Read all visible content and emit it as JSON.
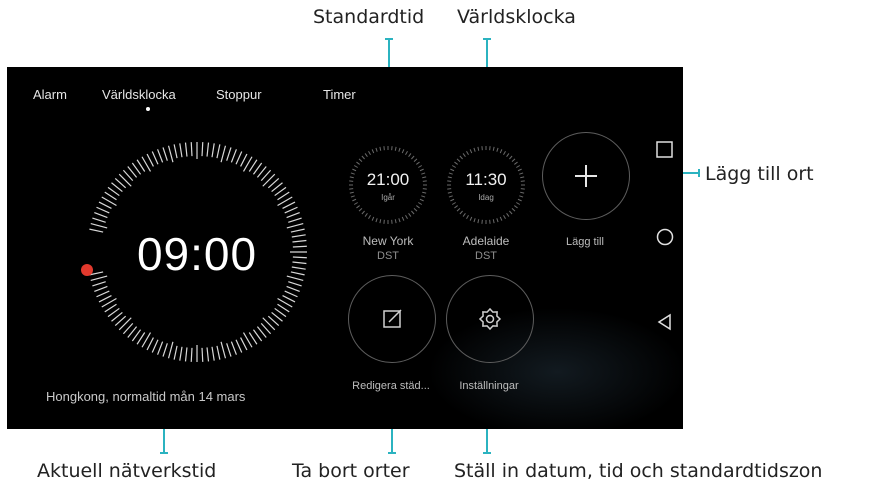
{
  "callouts": {
    "standardtid": "Standardtid",
    "varldsklocka": "Världsklocka",
    "lagg_till_ort": "Lägg till ort",
    "aktuell": "Aktuell nätverkstid",
    "ta_bort": "Ta bort orter",
    "stall_in": "Ställ in datum, tid och standardtidszon"
  },
  "tabs": [
    {
      "label": "Alarm"
    },
    {
      "label": "Världsklocka"
    },
    {
      "label": "Stoppur"
    },
    {
      "label": "Timer"
    }
  ],
  "active_tab": "Världsklocka",
  "local_clock": {
    "time": "09:00",
    "info": "Hongkong, normaltid  mån 14 mars"
  },
  "cities": [
    {
      "time": "21:00",
      "day": "Igår",
      "name": "New York",
      "dst": "DST"
    },
    {
      "time": "11:30",
      "day": "Idag",
      "name": "Adelaide",
      "dst": "DST"
    }
  ],
  "actions": {
    "add_label": "Lägg till",
    "edit_label": "Redigera städ...",
    "settings_label": "Inställningar"
  },
  "nav_icons": [
    "square-icon",
    "circle-icon",
    "triangle-back-icon"
  ],
  "colors": {
    "accent_line": "#2bb3c0",
    "red_dot": "#e2392d",
    "screen_bg": "#000000"
  }
}
